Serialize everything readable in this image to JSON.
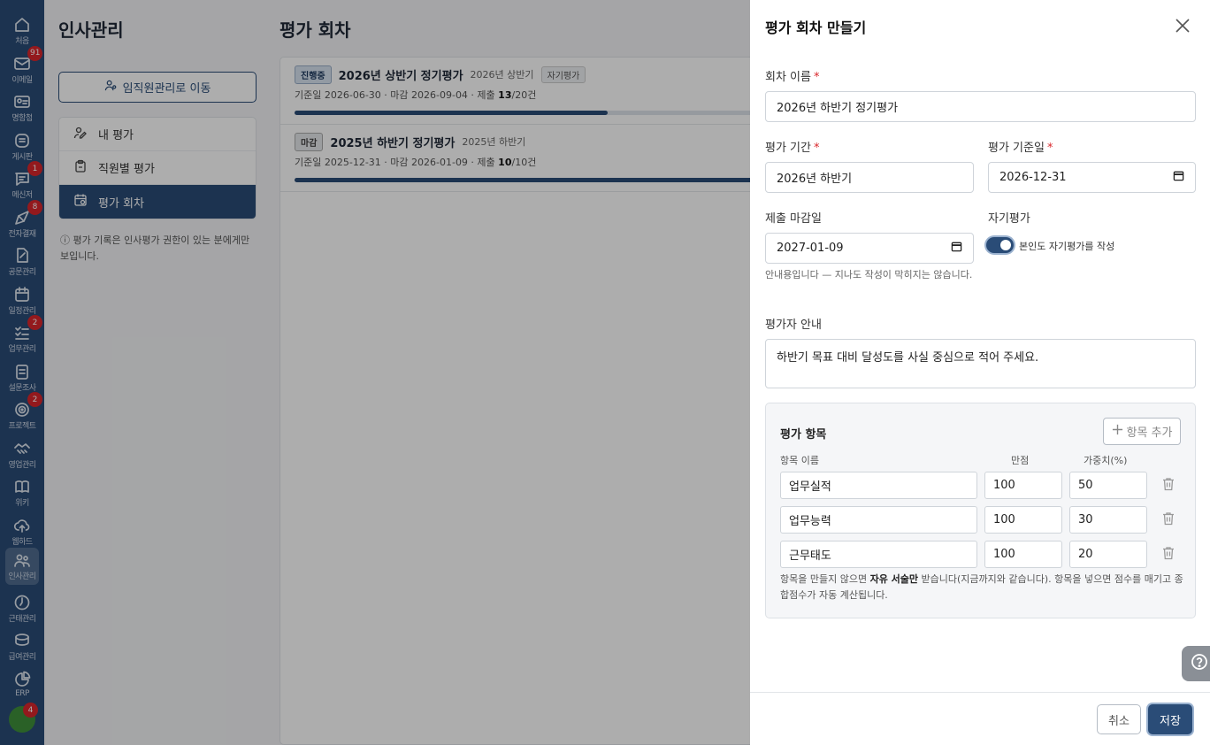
{
  "rail": {
    "items": [
      {
        "label": "처음",
        "icon": "home-icon",
        "badge": ""
      },
      {
        "label": "이메일",
        "icon": "mail-icon",
        "badge": "91"
      },
      {
        "label": "명함첩",
        "icon": "contact-card-icon",
        "badge": ""
      },
      {
        "label": "게시판",
        "icon": "board-icon",
        "badge": ""
      },
      {
        "label": "메신저",
        "icon": "messenger-icon",
        "badge": "1"
      },
      {
        "label": "전자결재",
        "icon": "approval-icon",
        "badge": "8"
      },
      {
        "label": "공문관리",
        "icon": "document-edit-icon",
        "badge": ""
      },
      {
        "label": "일정관리",
        "icon": "calendar-icon",
        "badge": ""
      },
      {
        "label": "업무관리",
        "icon": "task-list-icon",
        "badge": "2"
      },
      {
        "label": "설문조사",
        "icon": "survey-icon",
        "badge": ""
      },
      {
        "label": "프로젝트",
        "icon": "target-icon",
        "badge": "2"
      },
      {
        "label": "영업관리",
        "icon": "handshake-icon",
        "badge": ""
      },
      {
        "label": "위키",
        "icon": "book-icon",
        "badge": ""
      },
      {
        "label": "웹하드",
        "icon": "cloud-upload-icon",
        "badge": ""
      },
      {
        "label": "인사관리",
        "icon": "people-icon",
        "badge": ""
      },
      {
        "label": "근태관리",
        "icon": "clock-icon",
        "badge": ""
      },
      {
        "label": "급여관리",
        "icon": "coins-icon",
        "badge": ""
      },
      {
        "label": "ERP",
        "icon": "pie-chart-icon",
        "badge": ""
      }
    ],
    "avatar_badge": "4"
  },
  "hr": {
    "title": "인사관리",
    "goto_button": "임직원관리로 이동",
    "menu": [
      "내 평가",
      "직원별 평가",
      "평가 회차"
    ],
    "note": "평가 기록은 인사평가 권한이 있는 분에게만 보입니다."
  },
  "rounds": {
    "title": "평가 회차",
    "cards": [
      {
        "status": "진행중",
        "name": "2026년 상반기 정기평가",
        "period": "2026년 상반기",
        "tag": "자기평가",
        "info_prefix": "기준일 2026-06-30 · 마감 2026-09-04 · 제출 ",
        "submitted": "13",
        "total": "/20건",
        "progress": 0.65
      },
      {
        "status": "마감",
        "name": "2025년 하반기 정기평가",
        "period": "2025년 하반기",
        "tag": "",
        "info_prefix": "기준일 2025-12-31 · 마감 2026-01-09 · 제출 ",
        "submitted": "10",
        "total": "/10건",
        "progress": 1.0
      }
    ]
  },
  "drawer": {
    "title": "평가 회차 만들기",
    "round_name_label": "회차 이름",
    "round_name_value": "2026년 하반기 정기평가",
    "period_label": "평가 기간",
    "period_value": "2026년 하반기",
    "base_date_label": "평가 기준일",
    "base_date_value": "2026-12-31",
    "deadline_label": "제출 마감일",
    "deadline_value": "2027-01-09",
    "deadline_hint": "안내용입니다 — 지나도 작성이 막히지는 않습니다.",
    "self_eval_label": "자기평가",
    "self_eval_toggle_label": "본인도 자기평가를 작성",
    "self_eval_on": true,
    "guide_label": "평가자 안내",
    "guide_value": "하반기 목표 대비 달성도를 사실 중심으로 적어 주세요.",
    "items_title": "평가 항목",
    "add_item_button": "항목 추가",
    "col_name": "항목 이름",
    "col_max": "만점",
    "col_weight": "가중치(%)",
    "items": [
      {
        "name": "업무실적",
        "max": "100",
        "weight": "50"
      },
      {
        "name": "업무능력",
        "max": "100",
        "weight": "30"
      },
      {
        "name": "근무태도",
        "max": "100",
        "weight": "20"
      }
    ],
    "items_note_1": "항목을 만들지 않으면 ",
    "items_note_bold": "자유 서술만",
    "items_note_2": " 받습니다(지금까지와 같습니다). 항목을 넣으면 점수를 매기고 종합점수가 자동 계산됩니다.",
    "cancel_button": "취소",
    "save_button": "저장"
  },
  "colors": {
    "primary": "#2a4c77",
    "required": "#d9262b",
    "badge": "#d9262b"
  }
}
